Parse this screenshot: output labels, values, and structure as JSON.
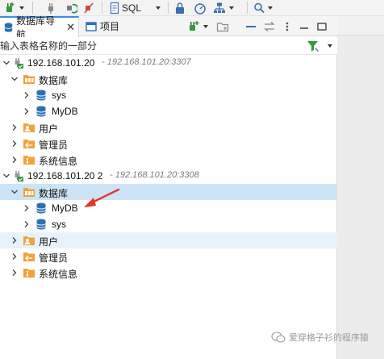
{
  "toolbar": {
    "sql_label": "SQL"
  },
  "tabs": [
    {
      "label": "数据库导航",
      "icon": "database-nav-icon",
      "close": "✕",
      "active": true
    },
    {
      "label": "项目",
      "icon": "project-icon",
      "active": false
    }
  ],
  "filter": {
    "placeholder": "输入表格名称的一部分"
  },
  "tree": {
    "connections": [
      {
        "name": "192.168.101.20",
        "address": "- 192.168.101.20:3307",
        "databases_label": "数据库",
        "databases": [
          "sys",
          "MyDB"
        ],
        "users_label": "用户",
        "admins_label": "管理员",
        "sysinfo_label": "系统信息"
      },
      {
        "name": "192.168.101.20 2",
        "address": "- 192.168.101.20:3308",
        "databases_label": "数据库",
        "databases": [
          "MyDB",
          "sys"
        ],
        "users_label": "用户",
        "admins_label": "管理员",
        "sysinfo_label": "系统信息"
      }
    ]
  },
  "watermark": {
    "text": "爱穿格子衫的程序猿"
  },
  "colors": {
    "accent": "#3d8ee5",
    "selected_row": "#cde4f7",
    "folder": "#f0a23b",
    "database": "#2d6fb3",
    "annotation_arrow": "#e8332a"
  }
}
